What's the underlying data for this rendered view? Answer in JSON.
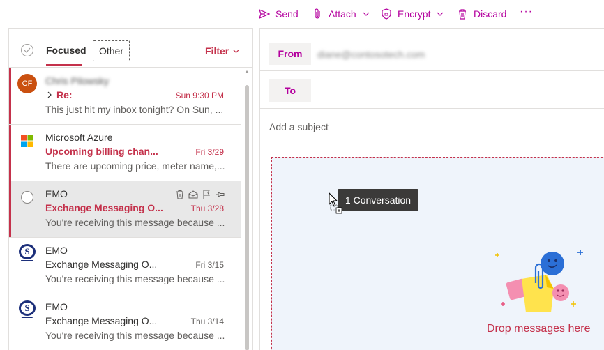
{
  "toolbar": {
    "send_label": "Send",
    "attach_label": "Attach",
    "encrypt_label": "Encrypt",
    "discard_label": "Discard",
    "more_label": "···"
  },
  "maillist": {
    "tabs": {
      "focused": "Focused",
      "other": "Other"
    },
    "filter_label": "Filter",
    "messages": [
      {
        "avatar_initials": "CF",
        "sender": "Chris Pilowsky",
        "subject": "Re:",
        "date": "Sun 9:30 PM",
        "preview": "This just hit my inbox tonight? On Sun, ..."
      },
      {
        "sender": "Microsoft Azure",
        "subject": "Upcoming billing chan...",
        "date": "Fri 3/29",
        "preview": "There are upcoming price, meter name,..."
      },
      {
        "sender": "EMO",
        "subject": "Exchange Messaging O...",
        "date": "Thu 3/28",
        "preview": "You're receiving this message because ..."
      },
      {
        "sender": "EMO",
        "subject": "Exchange Messaging O...",
        "date": "Fri 3/15",
        "preview": "You're receiving this message because ..."
      },
      {
        "sender": "EMO",
        "subject": "Exchange Messaging O...",
        "date": "Thu 3/14",
        "preview": "You're receiving this message because ..."
      }
    ]
  },
  "compose": {
    "from_label": "From",
    "from_address": "diane@contosotech.com",
    "to_label": "To",
    "subject_placeholder": "Add a subject",
    "drop_text": "Drop messages here"
  },
  "drag": {
    "tooltip": "1 Conversation"
  },
  "colors": {
    "accent": "#b4009e",
    "unread": "#c4314b",
    "drop_bg": "#eff4fb"
  }
}
